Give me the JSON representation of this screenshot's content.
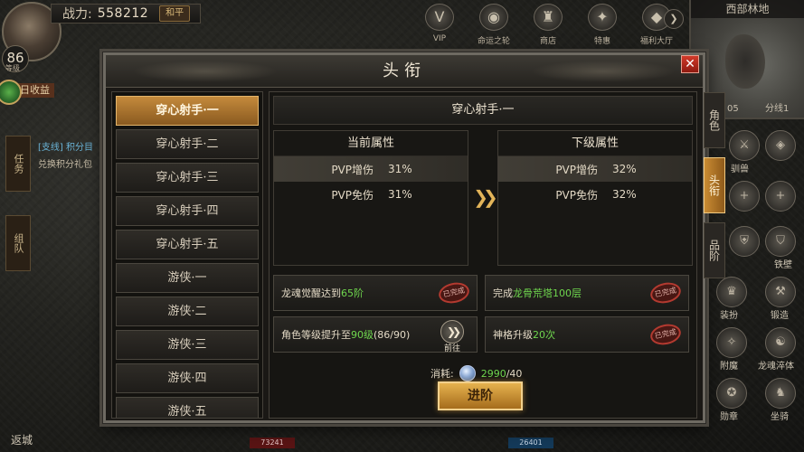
{
  "hud": {
    "power_label": "战力:",
    "power_value": "558212",
    "peace_mode": "和平",
    "level": "86",
    "level_sub": "等级",
    "income_label": "日收益",
    "left_tabs": [
      "任务",
      "组队"
    ],
    "quest_text": "[支线] 积分目",
    "quest_text2": "兑换积分礼包",
    "top_icons": [
      {
        "icon": "vip-icon",
        "glyph": "V",
        "label": "VIP"
      },
      {
        "icon": "wheel-icon",
        "glyph": "◉",
        "label": "命运之轮"
      },
      {
        "icon": "shop-icon",
        "glyph": "♜",
        "label": "商店"
      },
      {
        "icon": "gift-icon",
        "glyph": "✦",
        "label": "特惠"
      },
      {
        "icon": "bag-icon",
        "glyph": "◆",
        "label": "福利大厅"
      }
    ],
    "minimap_title": "西部林地",
    "minimap_coord": "05",
    "minimap_line": "分线1",
    "skills": [
      "驯兽",
      "铁壁",
      "装扮",
      "锻造",
      "附魔",
      "龙魂淬体",
      "勋章",
      "坐骑"
    ],
    "bottom_left": "返城",
    "hp_text": "73241",
    "mp_text": "26401"
  },
  "modal": {
    "title": "头衔",
    "close_label": "✕",
    "titles": [
      "穿心射手·一",
      "穿心射手·二",
      "穿心射手·三",
      "穿心射手·四",
      "穿心射手·五",
      "游侠·一",
      "游侠·二",
      "游侠·三",
      "游侠·四",
      "游侠·五"
    ],
    "selected_index": 0,
    "selected_title": "穿心射手·一",
    "current_attr": {
      "header": "当前属性",
      "rows": [
        {
          "name": "PVP增伤",
          "value": "31%"
        },
        {
          "name": "PVP免伤",
          "value": "31%"
        }
      ]
    },
    "next_attr": {
      "header": "下级属性",
      "rows": [
        {
          "name": "PVP增伤",
          "value": "32%"
        },
        {
          "name": "PVP免伤",
          "value": "32%"
        }
      ]
    },
    "conditions": [
      {
        "prefix": "龙魂觉醒达到",
        "highlight": "65阶",
        "suffix": "",
        "status": "已完成"
      },
      {
        "prefix": "完成",
        "highlight": "龙骨荒塔100层",
        "suffix": "",
        "status": "已完成"
      },
      {
        "prefix": "角色等级提升至",
        "highlight": "90级",
        "suffix": "(86/90)",
        "go_label": "前往"
      },
      {
        "prefix": "神格升级",
        "highlight": "20次",
        "suffix": "",
        "status": "已完成"
      }
    ],
    "cost_label": "消耗:",
    "cost_have": "2990",
    "cost_need": "/40",
    "advance_label": "进阶",
    "right_tabs": [
      "角色",
      "头衔",
      "品阶"
    ],
    "active_right_tab": 1
  }
}
